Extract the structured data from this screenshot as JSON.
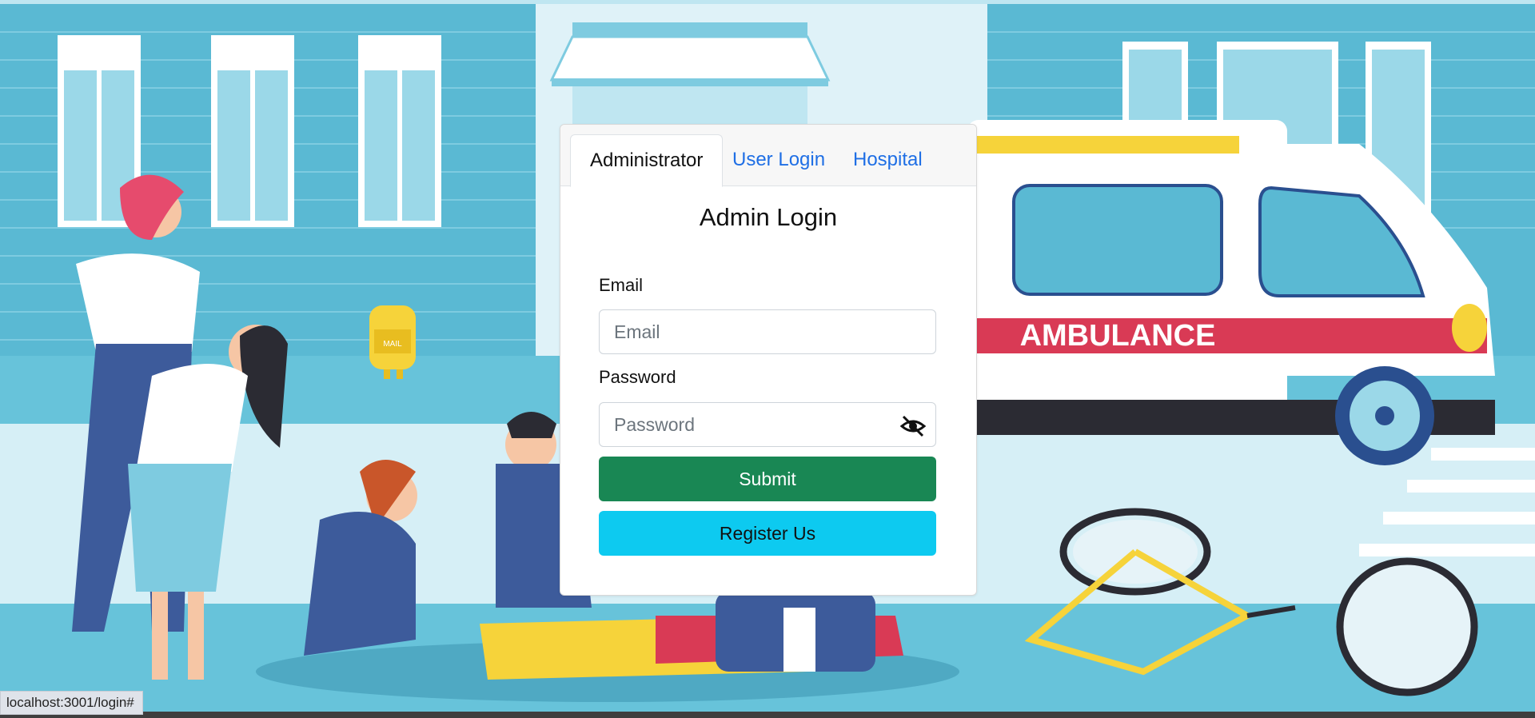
{
  "tabs": [
    {
      "label": "Administrator",
      "active": true
    },
    {
      "label": "User Login",
      "active": false
    },
    {
      "label": "Hospital",
      "active": false
    }
  ],
  "form": {
    "title": "Admin Login",
    "email_label": "Email",
    "email_placeholder": "Email",
    "email_value": "",
    "password_label": "Password",
    "password_placeholder": "Password",
    "password_value": "",
    "password_toggle_icon": "eye-slash-icon",
    "submit_label": "Submit",
    "register_label": "Register Us"
  },
  "background": {
    "mail_sign": "MAIL",
    "ambulance_text": "AMBULANCE"
  },
  "status_bar": {
    "url": "localhost:3001/login#"
  },
  "colors": {
    "submit": "#198754",
    "register": "#0dcaf0",
    "tab_link": "#1f6fe5",
    "wall": "#5fbfd6",
    "road": "#67c3da",
    "ambulance_stripe": "#d93a55"
  }
}
